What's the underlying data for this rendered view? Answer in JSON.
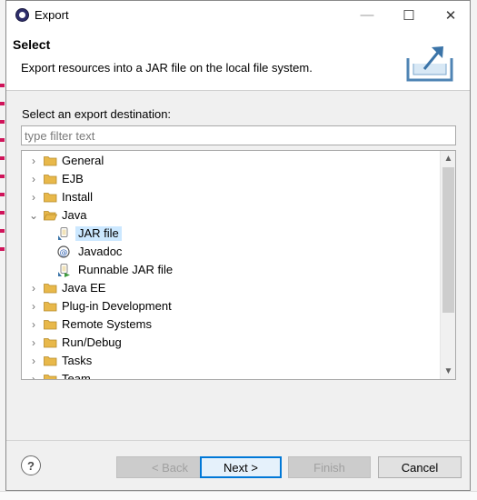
{
  "window": {
    "title": "Export",
    "minimize_glyph": "—",
    "maximize_glyph": "☐",
    "close_glyph": "✕"
  },
  "header": {
    "title": "Select",
    "description": "Export resources into a JAR file on the local file system.",
    "graphic_icon": "export-wizard-icon"
  },
  "content": {
    "label": "Select an export destination:",
    "filter_placeholder": "type filter text"
  },
  "tree": {
    "items": [
      {
        "label": "General",
        "expanded": false,
        "icon": "folder-icon"
      },
      {
        "label": "EJB",
        "expanded": false,
        "icon": "folder-icon"
      },
      {
        "label": "Install",
        "expanded": false,
        "icon": "folder-icon"
      },
      {
        "label": "Java",
        "expanded": true,
        "icon": "folder-open-icon"
      },
      {
        "label": "JAR file",
        "child": true,
        "selected": true,
        "icon": "jar-file-icon"
      },
      {
        "label": "Javadoc",
        "child": true,
        "icon": "javadoc-icon"
      },
      {
        "label": "Runnable JAR file",
        "child": true,
        "icon": "runnable-jar-icon"
      },
      {
        "label": "Java EE",
        "expanded": false,
        "icon": "folder-icon"
      },
      {
        "label": "Plug-in Development",
        "expanded": false,
        "icon": "folder-icon"
      },
      {
        "label": "Remote Systems",
        "expanded": false,
        "icon": "folder-icon"
      },
      {
        "label": "Run/Debug",
        "expanded": false,
        "icon": "folder-icon"
      },
      {
        "label": "Tasks",
        "expanded": false,
        "icon": "folder-icon"
      },
      {
        "label": "Team",
        "expanded": false,
        "icon": "folder-icon"
      }
    ]
  },
  "footer": {
    "help_glyph": "?",
    "back_label": "< Back",
    "next_label": "Next >",
    "finish_label": "Finish",
    "cancel_label": "Cancel"
  },
  "colors": {
    "selection": "#cce8ff",
    "default_button_border": "#0078d7",
    "folder": "#e8b84a"
  }
}
